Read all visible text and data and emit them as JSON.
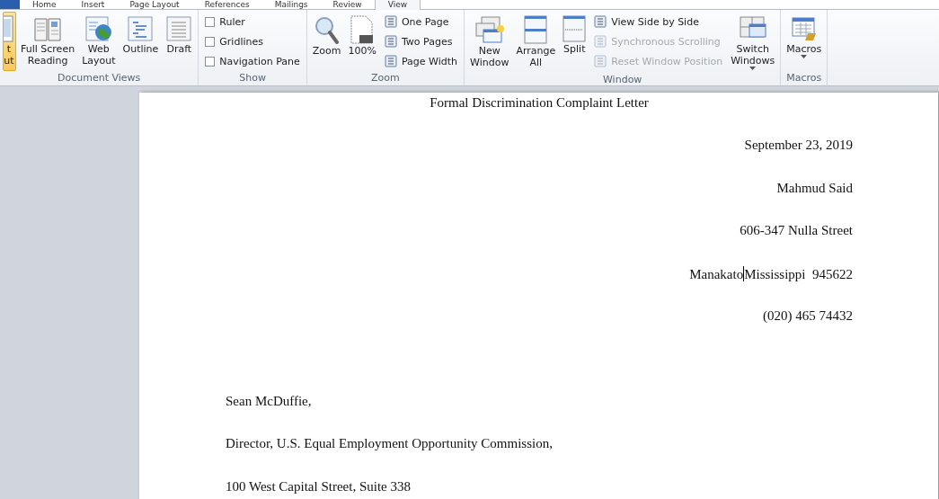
{
  "tabs": [
    {
      "label": "Home",
      "selected": false
    },
    {
      "label": "Insert",
      "selected": false
    },
    {
      "label": "Page Layout",
      "selected": false
    },
    {
      "label": "References",
      "selected": false
    },
    {
      "label": "Mailings",
      "selected": false
    },
    {
      "label": "Review",
      "selected": false
    },
    {
      "label": "View",
      "selected": true
    }
  ],
  "ribbon": {
    "groups": [
      {
        "label": "Document Views",
        "items": [
          {
            "kind": "large",
            "label": "t\nut",
            "selected": true
          },
          {
            "kind": "large",
            "label": "Full Screen\nReading",
            "selected": false
          },
          {
            "kind": "large",
            "label": "Web\nLayout",
            "selected": false
          },
          {
            "kind": "large",
            "label": "Outline",
            "selected": false
          },
          {
            "kind": "large",
            "label": "Draft",
            "selected": false
          }
        ]
      },
      {
        "label": "Show",
        "items": [
          {
            "kind": "stack",
            "entries": [
              {
                "kind": "checkbox",
                "label": "Ruler",
                "checked": false
              },
              {
                "kind": "checkbox",
                "label": "Gridlines",
                "checked": false
              },
              {
                "kind": "checkbox",
                "label": "Navigation Pane",
                "checked": false
              }
            ]
          }
        ]
      },
      {
        "label": "Zoom",
        "items": [
          {
            "kind": "large",
            "label": "Zoom",
            "selected": false
          },
          {
            "kind": "large",
            "label": "100%",
            "selected": false
          },
          {
            "kind": "stack",
            "entries": [
              {
                "kind": "small",
                "label": "One Page",
                "disabled": false
              },
              {
                "kind": "small",
                "label": "Two Pages",
                "disabled": false
              },
              {
                "kind": "small",
                "label": "Page Width",
                "disabled": false
              }
            ]
          }
        ]
      },
      {
        "label": "Window",
        "items": [
          {
            "kind": "large",
            "label": "New\nWindow",
            "selected": false
          },
          {
            "kind": "large",
            "label": "Arrange\nAll",
            "selected": false
          },
          {
            "kind": "large",
            "label": "Split",
            "selected": false
          },
          {
            "kind": "stack",
            "entries": [
              {
                "kind": "small",
                "label": "View Side by Side",
                "disabled": false
              },
              {
                "kind": "small",
                "label": "Synchronous Scrolling",
                "disabled": true
              },
              {
                "kind": "small",
                "label": "Reset Window Position",
                "disabled": true
              }
            ]
          },
          {
            "kind": "large",
            "label": "Switch\nWindows",
            "selected": false,
            "dropdown": true
          }
        ]
      },
      {
        "label": "Macros",
        "items": [
          {
            "kind": "large",
            "label": "Macros",
            "selected": false,
            "dropdown": true
          }
        ]
      }
    ]
  },
  "document": {
    "title": "Formal Discrimination Complaint Letter",
    "sender_block": [
      {
        "text": "September 23, 2019"
      },
      {
        "text": "Mahmud Said"
      },
      {
        "text": "606-347 Nulla Street"
      },
      {
        "text": "Manakato",
        "text_after_cursor": "Mississippi  945622"
      },
      {
        "text": "(020) 465 74432"
      }
    ],
    "recipient_block": [
      {
        "text": "Sean McDuffie,"
      },
      {
        "text": "Director, U.S. Equal Employment Opportunity Commission,"
      },
      {
        "text": "100 West Capital Street, Suite 338"
      }
    ]
  }
}
